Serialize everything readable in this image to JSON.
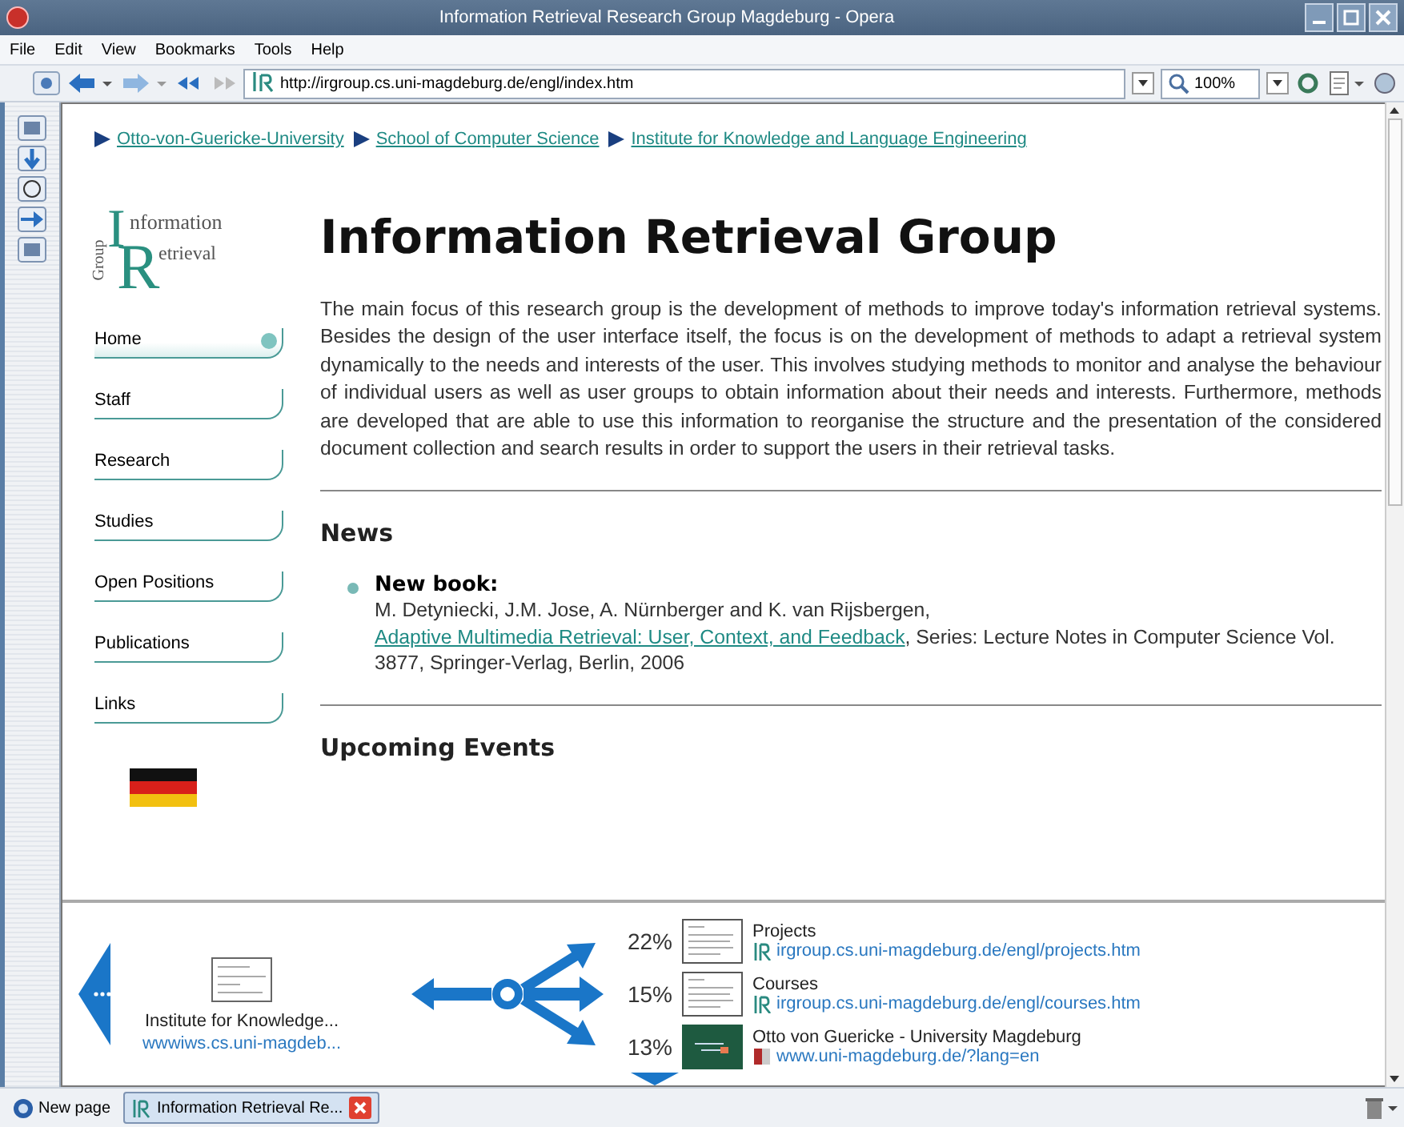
{
  "window": {
    "title": "Information Retrieval Research Group Magdeburg - Opera"
  },
  "menu": [
    "File",
    "Edit",
    "View",
    "Bookmarks",
    "Tools",
    "Help"
  ],
  "address_bar": {
    "url": "http://irgroup.cs.uni-magdeburg.de/engl/index.htm",
    "zoom": "100%"
  },
  "breadcrumb": [
    "Otto-von-Guericke-University",
    "School of Computer Science",
    "Institute for Knowledge and Language Engineering"
  ],
  "logo": {
    "side": "Group",
    "big_1": "I",
    "small_1": "nformation",
    "big_2": "R",
    "small_2": "etrieval"
  },
  "nav": [
    {
      "label": "Home",
      "selected": true
    },
    {
      "label": "Staff",
      "selected": false
    },
    {
      "label": "Research",
      "selected": false
    },
    {
      "label": "Studies",
      "selected": false
    },
    {
      "label": "Open Positions",
      "selected": false
    },
    {
      "label": "Publications",
      "selected": false
    },
    {
      "label": "Links",
      "selected": false
    }
  ],
  "heading": "Information Retrieval Group",
  "intro": "The main focus of this research group is the development of methods to improve today's information retrieval systems. Besides the design of the user interface itself, the focus is on the development of methods to adapt a retrieval system dynamically to the needs and interests of the user. This involves studying methods to monitor and analyse the behaviour of individual users as well as user groups to obtain information about their needs and interests. Furthermore, methods are developed that are able to use this information to reorganise the structure and the presentation of the considered document collection and search results in order to support the users in their retrieval tasks.",
  "news": {
    "heading": "News",
    "items": [
      {
        "title": "New book:",
        "before": "M. Detyniecki, J.M. Jose, A. Nürnberger and K. van Rijsbergen,",
        "link": "Adaptive Multimedia Retrieval: User, Context, and Feedback",
        "after": ", Series: Lecture Notes in Computer Science Vol. 3877, Springer-Verlag, Berlin, 2006"
      }
    ]
  },
  "events": {
    "heading": "Upcoming Events"
  },
  "fast_forward": {
    "back": {
      "title": "Institute for Knowledge...",
      "url": "wwwiws.cs.uni-magdeb..."
    },
    "links": [
      {
        "percent": "22%",
        "title": "Projects",
        "url": "irgroup.cs.uni-magdeburg.de/engl/projects.htm",
        "kind": "ir"
      },
      {
        "percent": "15%",
        "title": "Courses",
        "url": "irgroup.cs.uni-magdeburg.de/engl/courses.htm",
        "kind": "ir"
      },
      {
        "percent": "13%",
        "title": "Otto von Guericke - University Magdeburg",
        "url": "www.uni-magdeburg.de/?lang=en",
        "kind": "uni"
      }
    ]
  },
  "tabbar": {
    "new_page": "New page",
    "tabs": [
      {
        "label": "Information Retrieval Re...",
        "selected": true
      }
    ]
  }
}
